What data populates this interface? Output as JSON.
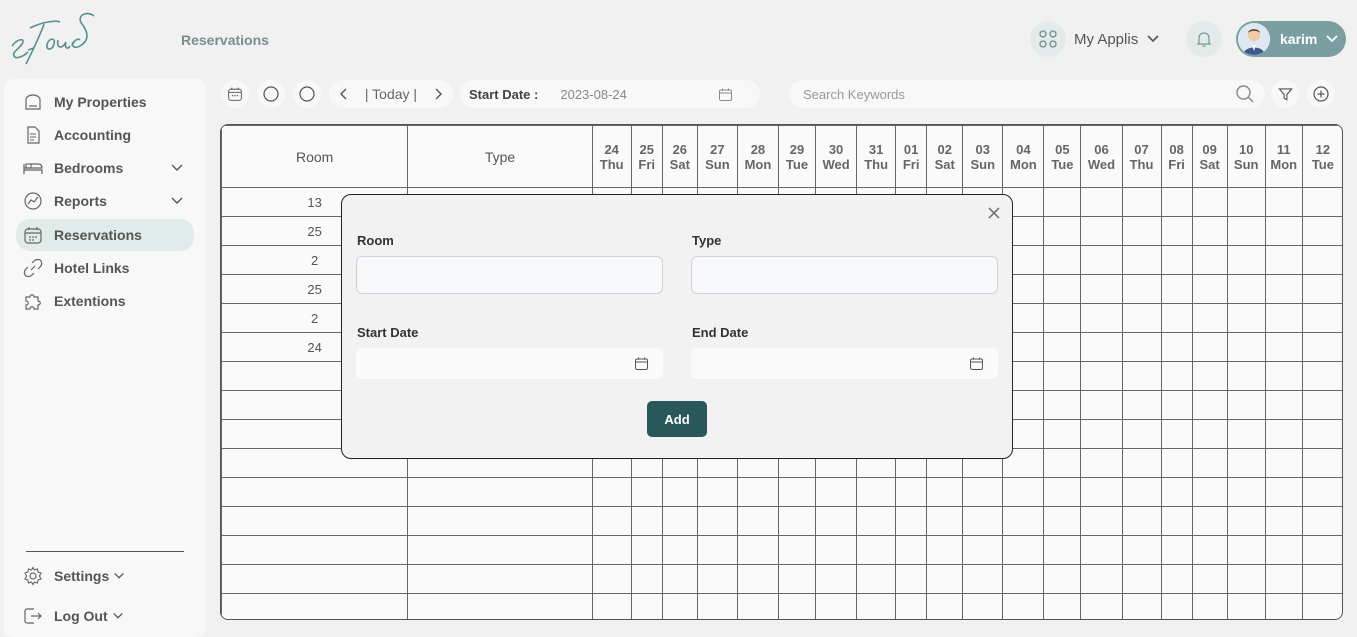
{
  "brand": {
    "logo_text": "e-TourS"
  },
  "header": {
    "page_title": "Reservations",
    "apps_label": "My Applis",
    "user_name": "karim"
  },
  "sidebar": {
    "items": [
      {
        "label": "My Properties",
        "icon": "home-icon"
      },
      {
        "label": "Accounting",
        "icon": "document-icon"
      },
      {
        "label": "Bedrooms",
        "icon": "bed-icon",
        "has_submenu": true
      },
      {
        "label": "Reports",
        "icon": "chart-icon",
        "has_submenu": true
      },
      {
        "label": "Reservations",
        "icon": "calendar-icon",
        "active": true
      },
      {
        "label": "Hotel Links",
        "icon": "link-icon"
      },
      {
        "label": "Extentions",
        "icon": "puzzle-icon"
      }
    ],
    "bottom": [
      {
        "label": "Settings",
        "icon": "gear-icon"
      },
      {
        "label": "Log Out",
        "icon": "logout-icon"
      }
    ]
  },
  "toolbar": {
    "today_label": "| Today |",
    "start_date_label": "Start Date :",
    "start_date_value": "2023-08-24",
    "search_placeholder": "Search Keywords"
  },
  "grid": {
    "col_room": "Room",
    "col_type": "Type",
    "days": [
      {
        "d": "24",
        "w": "Thu"
      },
      {
        "d": "25",
        "w": "Fri"
      },
      {
        "d": "26",
        "w": "Sat"
      },
      {
        "d": "27",
        "w": "Sun"
      },
      {
        "d": "28",
        "w": "Mon"
      },
      {
        "d": "29",
        "w": "Tue"
      },
      {
        "d": "30",
        "w": "Wed"
      },
      {
        "d": "31",
        "w": "Thu"
      },
      {
        "d": "01",
        "w": "Fri"
      },
      {
        "d": "02",
        "w": "Sat"
      },
      {
        "d": "03",
        "w": "Sun"
      },
      {
        "d": "04",
        "w": "Mon"
      },
      {
        "d": "05",
        "w": "Tue"
      },
      {
        "d": "06",
        "w": "Wed"
      },
      {
        "d": "07",
        "w": "Thu"
      },
      {
        "d": "08",
        "w": "Fri"
      },
      {
        "d": "09",
        "w": "Sat"
      },
      {
        "d": "10",
        "w": "Sun"
      },
      {
        "d": "11",
        "w": "Mon"
      },
      {
        "d": "12",
        "w": "Tue"
      }
    ],
    "rooms": [
      "13",
      "25",
      "2",
      "25",
      "2",
      "24",
      "",
      "",
      "",
      "",
      "",
      "",
      "",
      "",
      ""
    ]
  },
  "modal": {
    "room_label": "Room",
    "type_label": "Type",
    "start_label": "Start Date",
    "end_label": "End Date",
    "room_value": "",
    "type_value": "",
    "add_label": "Add"
  },
  "colors": {
    "accent": "#28585c",
    "user_pill": "#7b9fa1",
    "active_item": "#e1ebe9"
  }
}
